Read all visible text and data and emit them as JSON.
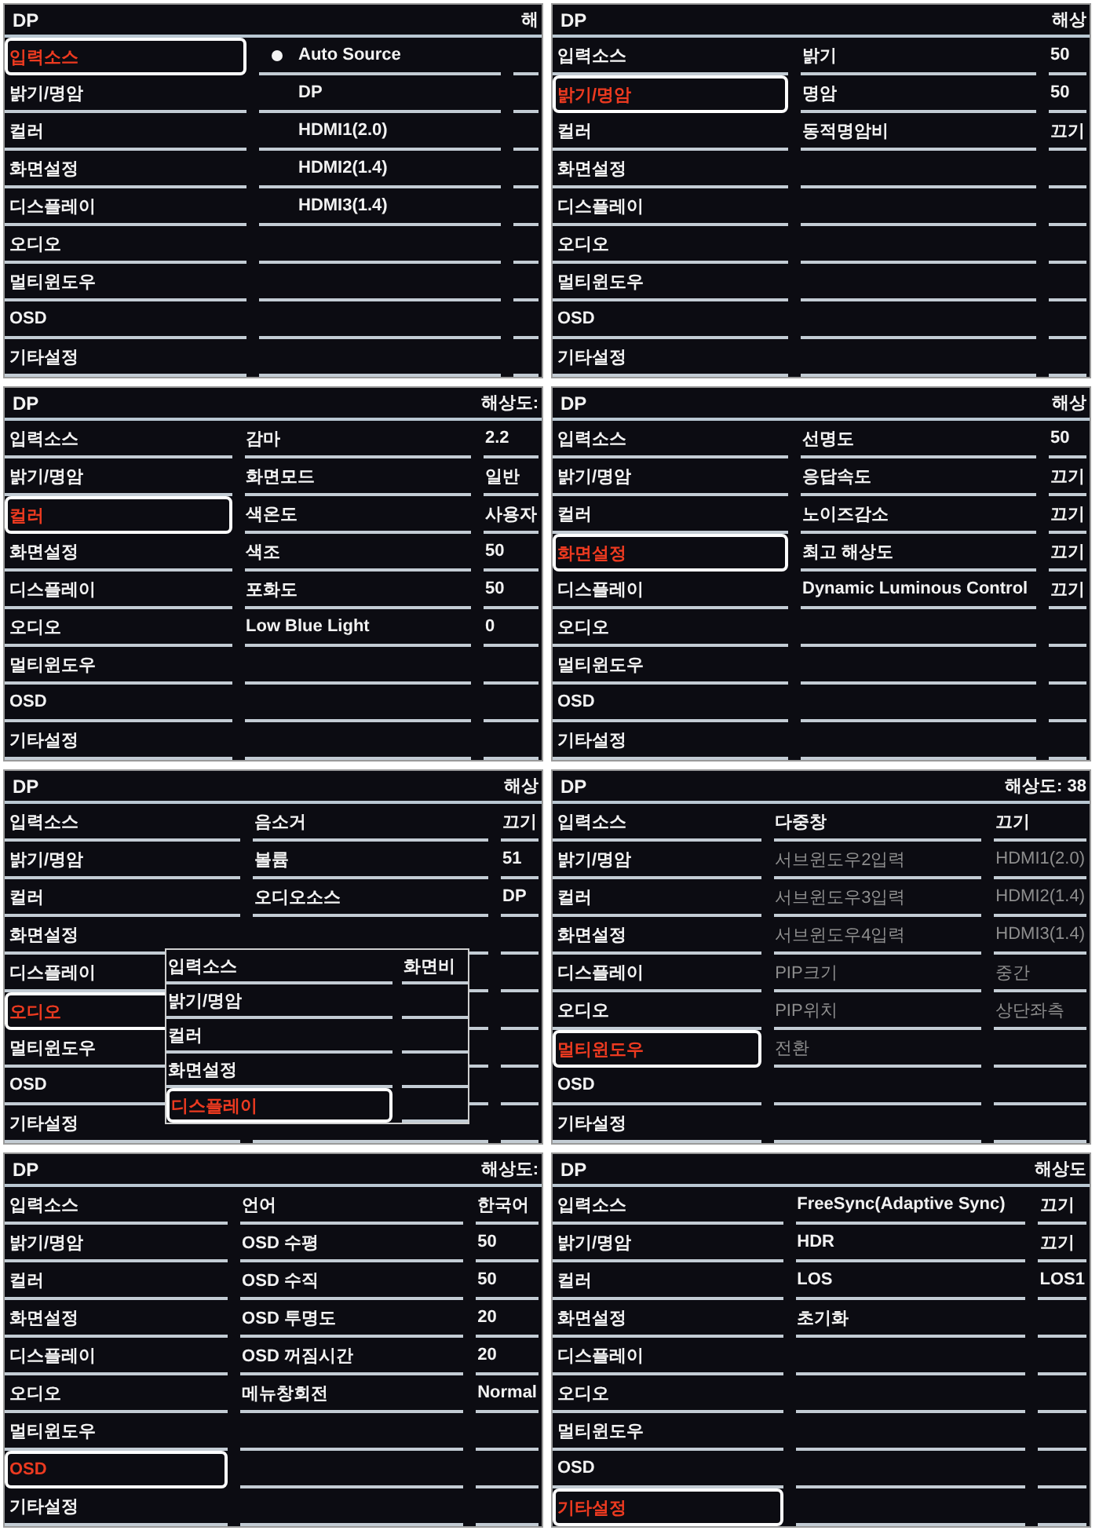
{
  "panels": [
    {
      "source": "DP",
      "resolution_label": "해",
      "menu": [
        {
          "label": "입력소스",
          "selected": true
        },
        {
          "label": "밝기/명암",
          "selected": false
        },
        {
          "label": "컬러",
          "selected": false
        },
        {
          "label": "화면설정",
          "selected": false
        },
        {
          "label": "디스플레이",
          "selected": false
        },
        {
          "label": "오디오",
          "selected": false
        },
        {
          "label": "멀티윈도우",
          "selected": false
        },
        {
          "label": "OSD",
          "selected": false
        },
        {
          "label": "기타설정",
          "selected": false
        }
      ],
      "settings": [
        {
          "label": "Auto Source",
          "current": true
        },
        {
          "label": "DP",
          "current": false
        },
        {
          "label": "HDMI1(2.0)",
          "current": false
        },
        {
          "label": "HDMI2(1.4)",
          "current": false
        },
        {
          "label": "HDMI3(1.4)",
          "current": false
        }
      ]
    },
    {
      "source": "DP",
      "resolution_label": "해상",
      "menu": [
        {
          "label": "입력소스",
          "selected": false
        },
        {
          "label": "밝기/명암",
          "selected": true
        },
        {
          "label": "컬러",
          "selected": false
        },
        {
          "label": "화면설정",
          "selected": false
        },
        {
          "label": "디스플레이",
          "selected": false
        },
        {
          "label": "오디오",
          "selected": false
        },
        {
          "label": "멀티윈도우",
          "selected": false
        },
        {
          "label": "OSD",
          "selected": false
        },
        {
          "label": "기타설정",
          "selected": false
        }
      ],
      "settings": [
        {
          "label": "밝기",
          "value": "50"
        },
        {
          "label": "명암",
          "value": "50"
        },
        {
          "label": "동적명암비",
          "value": "끄기"
        }
      ]
    },
    {
      "source": "DP",
      "resolution_label": "해상도:",
      "menu": [
        {
          "label": "입력소스",
          "selected": false
        },
        {
          "label": "밝기/명암",
          "selected": false
        },
        {
          "label": "컬러",
          "selected": true
        },
        {
          "label": "화면설정",
          "selected": false
        },
        {
          "label": "디스플레이",
          "selected": false
        },
        {
          "label": "오디오",
          "selected": false
        },
        {
          "label": "멀티윈도우",
          "selected": false
        },
        {
          "label": "OSD",
          "selected": false
        },
        {
          "label": "기타설정",
          "selected": false
        }
      ],
      "settings": [
        {
          "label": "감마",
          "value": "2.2"
        },
        {
          "label": "화면모드",
          "value": "일반"
        },
        {
          "label": "색온도",
          "value": "사용자"
        },
        {
          "label": "색조",
          "value": "50"
        },
        {
          "label": "포화도",
          "value": "50"
        },
        {
          "label": "Low Blue Light",
          "value": "0"
        }
      ]
    },
    {
      "source": "DP",
      "resolution_label": "해상",
      "menu": [
        {
          "label": "입력소스",
          "selected": false
        },
        {
          "label": "밝기/명암",
          "selected": false
        },
        {
          "label": "컬러",
          "selected": false
        },
        {
          "label": "화면설정",
          "selected": true
        },
        {
          "label": "디스플레이",
          "selected": false
        },
        {
          "label": "오디오",
          "selected": false
        },
        {
          "label": "멀티윈도우",
          "selected": false
        },
        {
          "label": "OSD",
          "selected": false
        },
        {
          "label": "기타설정",
          "selected": false
        }
      ],
      "settings": [
        {
          "label": "선명도",
          "value": "50"
        },
        {
          "label": "응답속도",
          "value": "끄기"
        },
        {
          "label": "노이즈감소",
          "value": "끄기"
        },
        {
          "label": "최고 해상도",
          "value": "끄기"
        },
        {
          "label": "Dynamic Luminous Control",
          "value": "끄기"
        }
      ]
    },
    {
      "source": "DP",
      "resolution_label": "해상",
      "menu": [
        {
          "label": "입력소스",
          "selected": false
        },
        {
          "label": "밝기/명암",
          "selected": false
        },
        {
          "label": "컬러",
          "selected": false
        },
        {
          "label": "화면설정",
          "selected": false
        },
        {
          "label": "디스플레이",
          "selected": false
        },
        {
          "label": "오디오",
          "selected": true
        },
        {
          "label": "멀티윈도우",
          "selected": false
        },
        {
          "label": "OSD",
          "selected": false
        },
        {
          "label": "기타설정",
          "selected": false
        }
      ],
      "settings": [
        {
          "label": "음소거",
          "value": "끄기"
        },
        {
          "label": "볼륨",
          "value": "51"
        },
        {
          "label": "오디오소스",
          "value": "DP"
        }
      ],
      "overlay": {
        "menu": [
          {
            "label": "입력소스",
            "selected": false
          },
          {
            "label": "밝기/명암",
            "selected": false
          },
          {
            "label": "컬러",
            "selected": false
          },
          {
            "label": "화면설정",
            "selected": false
          },
          {
            "label": "디스플레이",
            "selected": true
          }
        ],
        "settings": [
          {
            "label": "화면비"
          }
        ]
      }
    },
    {
      "source": "DP",
      "resolution_label": "해상도: 38",
      "menu": [
        {
          "label": "입력소스",
          "selected": false
        },
        {
          "label": "밝기/명암",
          "selected": false
        },
        {
          "label": "컬러",
          "selected": false
        },
        {
          "label": "화면설정",
          "selected": false
        },
        {
          "label": "디스플레이",
          "selected": false
        },
        {
          "label": "오디오",
          "selected": false
        },
        {
          "label": "멀티윈도우",
          "selected": true
        },
        {
          "label": "OSD",
          "selected": false
        },
        {
          "label": "기타설정",
          "selected": false
        }
      ],
      "settings": [
        {
          "label": "다중창",
          "value": "끄기",
          "disabled": false
        },
        {
          "label": "서브윈도우2입력",
          "value": "HDMI1(2.0)",
          "disabled": true
        },
        {
          "label": "서브윈도우3입력",
          "value": "HDMI2(1.4)",
          "disabled": true
        },
        {
          "label": "서브윈도우4입력",
          "value": "HDMI3(1.4)",
          "disabled": true
        },
        {
          "label": "PIP크기",
          "value": "중간",
          "disabled": true
        },
        {
          "label": "PIP위치",
          "value": "상단좌측",
          "disabled": true
        },
        {
          "label": "전환",
          "disabled": true
        }
      ]
    },
    {
      "source": "DP",
      "resolution_label": "해상도:",
      "menu": [
        {
          "label": "입력소스",
          "selected": false
        },
        {
          "label": "밝기/명암",
          "selected": false
        },
        {
          "label": "컬러",
          "selected": false
        },
        {
          "label": "화면설정",
          "selected": false
        },
        {
          "label": "디스플레이",
          "selected": false
        },
        {
          "label": "오디오",
          "selected": false
        },
        {
          "label": "멀티윈도우",
          "selected": false
        },
        {
          "label": "OSD",
          "selected": true
        },
        {
          "label": "기타설정",
          "selected": false
        }
      ],
      "settings": [
        {
          "label": "언어",
          "value": "한국어"
        },
        {
          "label": "OSD 수평",
          "value": "50"
        },
        {
          "label": "OSD 수직",
          "value": "50"
        },
        {
          "label": "OSD 투명도",
          "value": "20"
        },
        {
          "label": "OSD 꺼짐시간",
          "value": "20"
        },
        {
          "label": "메뉴창회전",
          "value": "Normal"
        }
      ]
    },
    {
      "source": "DP",
      "resolution_label": "해상도",
      "menu": [
        {
          "label": "입력소스",
          "selected": false
        },
        {
          "label": "밝기/명암",
          "selected": false
        },
        {
          "label": "컬러",
          "selected": false
        },
        {
          "label": "화면설정",
          "selected": false
        },
        {
          "label": "디스플레이",
          "selected": false
        },
        {
          "label": "오디오",
          "selected": false
        },
        {
          "label": "멀티윈도우",
          "selected": false
        },
        {
          "label": "OSD",
          "selected": false
        },
        {
          "label": "기타설정",
          "selected": true
        }
      ],
      "settings": [
        {
          "label": "FreeSync(Adaptive Sync)",
          "value": "끄기"
        },
        {
          "label": "HDR",
          "value": "끄기"
        },
        {
          "label": "LOS",
          "value": "LOS1"
        },
        {
          "label": "초기화"
        }
      ]
    }
  ]
}
